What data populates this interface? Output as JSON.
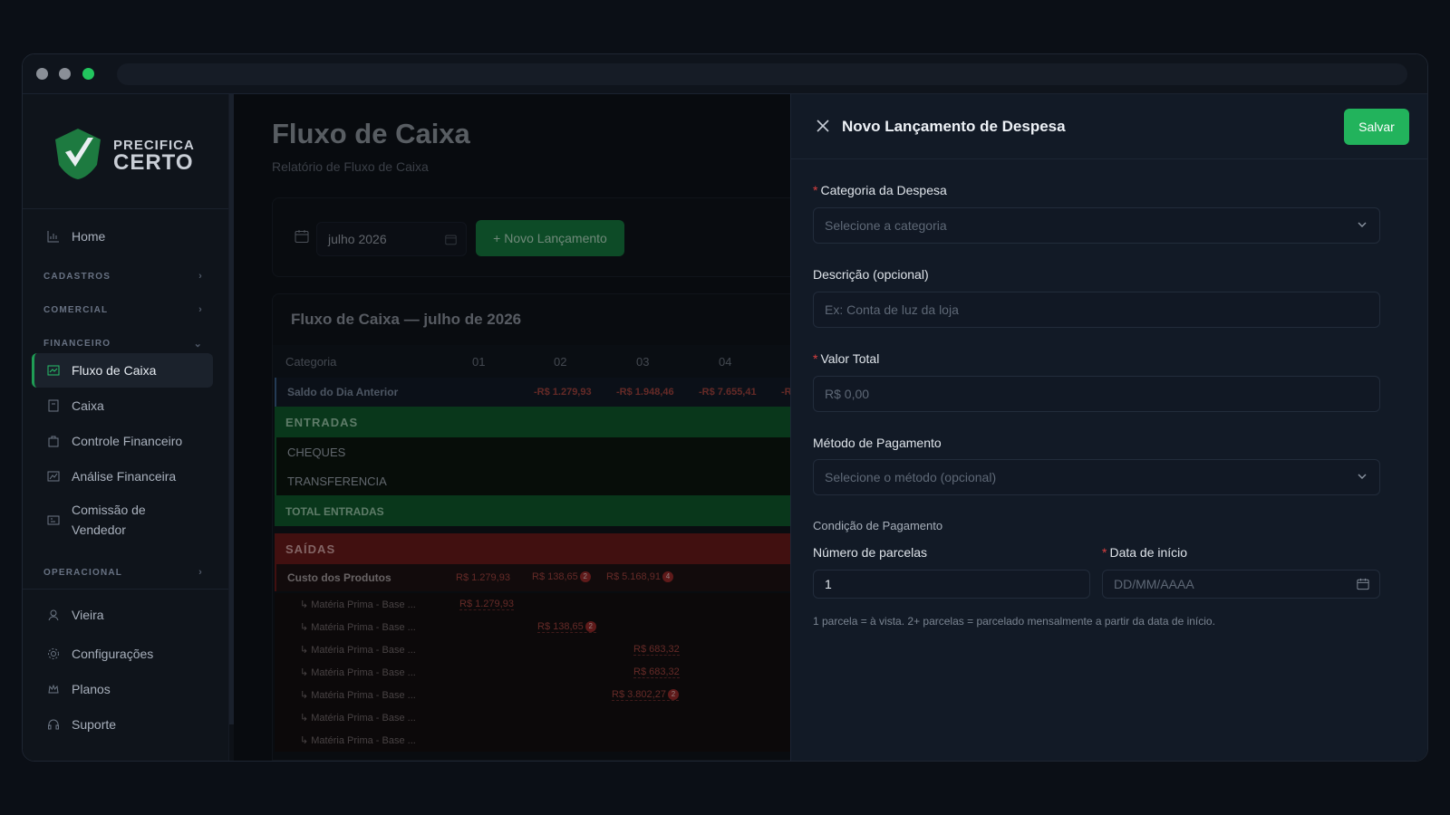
{
  "brand": {
    "line1": "PRECIFICA",
    "line2": "CERTO"
  },
  "sidebar": {
    "home": "Home",
    "sections": {
      "cadastros": "CADASTROS",
      "comercial": "COMERCIAL",
      "financeiro": "FINANCEIRO",
      "operacional": "OPERACIONAL"
    },
    "items": [
      {
        "label": "Fluxo de Caixa",
        "icon": "chart-line-icon"
      },
      {
        "label": "Caixa",
        "icon": "cash-register-icon"
      },
      {
        "label": "Controle Financeiro",
        "icon": "briefcase-icon"
      },
      {
        "label": "Análise Financeira",
        "icon": "analytics-icon"
      },
      {
        "label": "Comissão de Vendedor",
        "icon": "id-card-icon"
      }
    ],
    "user": "Vieira",
    "settings": "Configurações",
    "plans": "Planos",
    "support": "Suporte"
  },
  "page": {
    "title": "Fluxo de Caixa",
    "subtitle": "Relatório de Fluxo de Caixa"
  },
  "filter": {
    "month": "julho 2026",
    "new_button": "+ Novo Lançamento"
  },
  "table": {
    "title": "Fluxo de Caixa — julho de 2026",
    "headers": [
      "Categoria",
      "01",
      "02",
      "03",
      "04"
    ],
    "saldo": {
      "label": "Saldo do Dia Anterior",
      "values": [
        "",
        "-R$ 1.279,93",
        "-R$ 1.948,46",
        "-R$ 7.655,41",
        "-R"
      ]
    },
    "entradas": "ENTRADAS",
    "entradas_rows": [
      "CHEQUES",
      "TRANSFERENCIA"
    ],
    "total_entradas": "TOTAL ENTRADAS",
    "saidas": "SAÍDAS",
    "custo": {
      "label": "Custo dos Produtos",
      "v1": "R$ 1.279,93",
      "v2": "R$ 138,65",
      "b2": "2",
      "v3": "R$ 5.168,91",
      "b3": "4"
    },
    "sub_rows": [
      {
        "label": "↳ Matéria Prima - Base ...",
        "value": "R$ 1.279,93",
        "badge": ""
      },
      {
        "label": "↳ Matéria Prima - Base ...",
        "value": "R$ 138,65",
        "badge": "2"
      },
      {
        "label": "↳ Matéria Prima - Base ...",
        "value": "R$ 683,32",
        "badge": ""
      },
      {
        "label": "↳ Matéria Prima - Base ...",
        "value": "R$ 683,32",
        "badge": ""
      },
      {
        "label": "↳ Matéria Prima - Base ...",
        "value": "R$ 3.802,27",
        "badge": "2"
      },
      {
        "label": "↳ Matéria Prima - Base ...",
        "value": "",
        "badge": ""
      },
      {
        "label": "↳ Matéria Prima - Base ...",
        "value": "",
        "badge": ""
      }
    ]
  },
  "drawer": {
    "title": "Novo Lançamento de Despesa",
    "save": "Salvar",
    "category_label": "Categoria da Despesa",
    "category_placeholder": "Selecione a categoria",
    "description_label": "Descrição (opcional)",
    "description_placeholder": "Ex: Conta de luz da loja",
    "value_label": "Valor Total",
    "value_placeholder": "R$ 0,00",
    "method_label": "Método de Pagamento",
    "method_placeholder": "Selecione o método (opcional)",
    "condition_label": "Condição de Pagamento",
    "installments_label": "Número de parcelas",
    "installments_value": "1",
    "start_label": "Data de início",
    "start_placeholder": "DD/MM/AAAA",
    "hint": "1 parcela = à vista. 2+ parcelas = parcelado mensalmente a partir da data de início."
  },
  "colors": {
    "accent": "#22b35c",
    "entradas": "#157a3f",
    "saidas": "#8c1c1c",
    "negative": "#d2574f"
  }
}
